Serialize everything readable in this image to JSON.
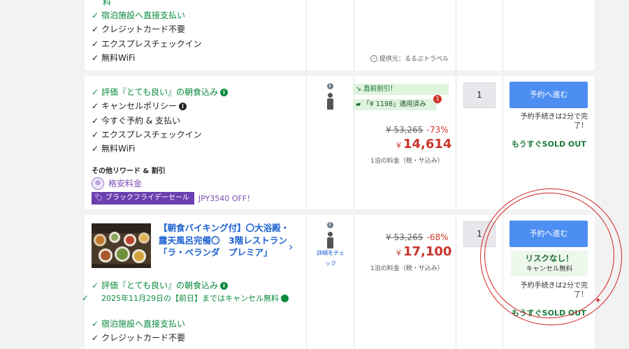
{
  "row1": {
    "top_char": "料",
    "features": [
      {
        "text": "宿泊施設へ直接支払い",
        "green": true
      },
      {
        "text": "クレジットカード不要",
        "green": false
      },
      {
        "text": "エクスプレスチェックイン",
        "green": false
      },
      {
        "text": "無料WiFi",
        "green": false
      }
    ],
    "provider": "提供元：るるぶトラベル"
  },
  "row2": {
    "features": [
      {
        "text": "評価『とても良い』の朝食込み",
        "green": true,
        "info": "green"
      },
      {
        "text": "キャンセルポリシー",
        "green": false,
        "info": "black"
      },
      {
        "text": "今すぐ予約 & 支払い",
        "green": false,
        "info": ""
      },
      {
        "text": "エクスプレスチェックイン",
        "green": false,
        "info": ""
      },
      {
        "text": "無料WiFi",
        "green": false,
        "info": ""
      }
    ],
    "rewards_title": "その他リワード & 割引",
    "cheap_rate": "格安料金",
    "bf_sale": "ブラックフライデーセール",
    "bf_off": "JPY3540 OFF！",
    "last_minute": "直前割引！",
    "coupon": "「¥ 1198」適用済み",
    "coupon_count": "1",
    "orig_price": "¥ 53,265",
    "discount": "-73%",
    "price_yen": "¥",
    "price": "14,614",
    "per_night": "1泊の料金（税・サ込み）",
    "qty": "1",
    "reserve": "予約へ進む",
    "note": "予約手続きは2分で完了！",
    "soldout": "もうすぐSOLD OUT"
  },
  "row3": {
    "room_title": "【朝食バイキング付】〇大浴殿・露天風呂完備〇　3階レストラン「ラ・ベランダ　プレミア」",
    "detail_link": "詳細をチェック",
    "features": [
      {
        "text": "評価『とても良い』の朝食込み",
        "green": true,
        "info": "green"
      },
      {
        "text": "2025年11月29日の【前日】まではキャンセル無料",
        "green": true,
        "info": "green"
      },
      {
        "text": "宿泊施設へ直接支払い",
        "green": true,
        "info": ""
      },
      {
        "text": "クレジットカード不要",
        "green": false,
        "info": ""
      }
    ],
    "orig_price": "¥ 53,265",
    "discount": "-68%",
    "price_yen": "¥",
    "price": "17,100",
    "per_night": "1泊の料金（税・サ込み）",
    "qty": "1",
    "reserve": "予約へ進む",
    "no_risk": "リスクなし！",
    "free_cancel": "キャンセル無料",
    "note": "予約手続きは2分で完了！",
    "soldout": "もうすぐSOLD OUT"
  },
  "colors": {
    "green": "#0b8a3e",
    "price_red": "#c8352b",
    "reserve_blue": "#4d8ef2",
    "purple": "#7a4fb5",
    "annotation_red": "#d32222"
  },
  "icons": [
    "check-icon",
    "info-icon",
    "person-icon",
    "chevron-right-icon",
    "tag-icon",
    "coupon-icon",
    "arrow-down-icon"
  ]
}
